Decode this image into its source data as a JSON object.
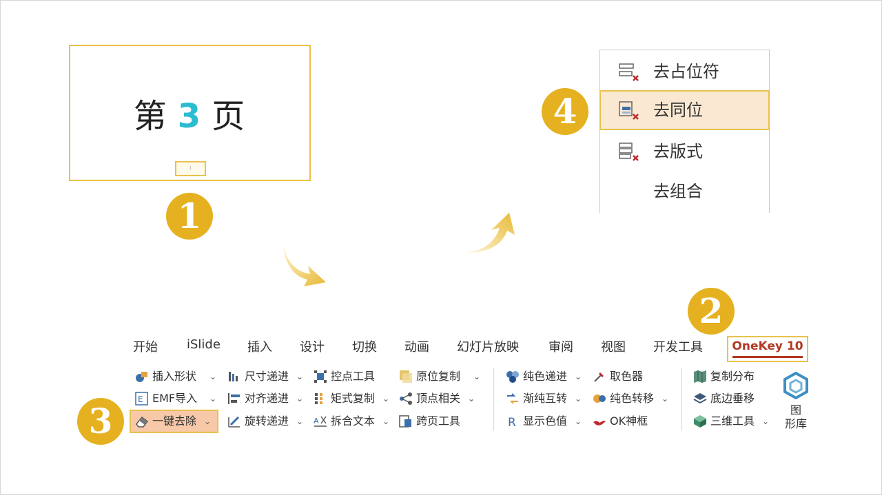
{
  "slide": {
    "title_prefix": "第",
    "title_number": "3",
    "title_suffix": "页",
    "footer_placeholder": "1"
  },
  "steps": [
    "1",
    "2",
    "3",
    "4"
  ],
  "context_menu": {
    "items": [
      {
        "label": "去占位符",
        "icon": "remove-placeholder-icon",
        "highlighted": false
      },
      {
        "label": "去同位",
        "icon": "remove-same-position-icon",
        "highlighted": true
      },
      {
        "label": "去版式",
        "icon": "remove-layout-icon",
        "highlighted": false
      },
      {
        "label": "去组合",
        "icon": "",
        "highlighted": false
      }
    ]
  },
  "ribbon": {
    "tabs": [
      "开始",
      "iSlide",
      "插入",
      "设计",
      "切换",
      "动画",
      "幻灯片放映",
      "审阅",
      "视图",
      "开发工具"
    ],
    "active_tab": "OneKey 10",
    "buttons": {
      "insert_shape": "插入形状",
      "emf_import": "EMF导入",
      "one_click_remove": "一键去除",
      "size_step": "尺寸递进",
      "align_step": "对齐递进",
      "rotate_step": "旋转递进",
      "control_point": "控点工具",
      "matrix_copy": "矩式复制",
      "split_merge_text": "拆合文本",
      "in_place_copy": "原位复制",
      "vertex_related": "顶点相关",
      "cross_page": "跨页工具",
      "solid_step": "纯色递进",
      "gradient_convert": "渐纯互转",
      "show_color": "显示色值",
      "eyedropper": "取色器",
      "solid_transfer": "纯色转移",
      "ok_frame": "OK神框",
      "copy_distribute": "复制分布",
      "bottom_perpendicular": "底边垂移",
      "3d_tools": "三维工具",
      "shape_library_1": "图",
      "shape_library_2": "形库"
    }
  },
  "colors": {
    "badge": "#e5b120",
    "highlight_border": "#e8c24a",
    "menu_highlight": "#fbe8d2",
    "button_highlight": "#f8c9a9",
    "active_tab_text": "#b13a23",
    "slide_number": "#2bbcd0"
  }
}
